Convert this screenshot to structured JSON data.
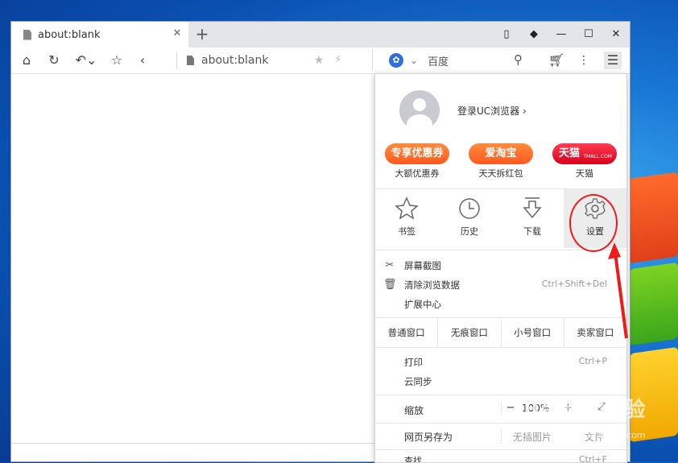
{
  "tab": {
    "title": "about:blank"
  },
  "address": {
    "url": "about:blank"
  },
  "search": {
    "engine_label": "百度"
  },
  "menu": {
    "login_text": "登录UC浏览器",
    "promos": [
      {
        "badge": "专享优惠券",
        "caption": "大额优惠券"
      },
      {
        "badge": "爱淘宝",
        "caption": "天天拆红包"
      },
      {
        "badge": "天猫",
        "sub": "TMALL.COM",
        "caption": "天猫"
      }
    ],
    "icons": [
      {
        "label": "书签"
      },
      {
        "label": "历史"
      },
      {
        "label": "下载"
      },
      {
        "label": "设置"
      }
    ],
    "rows": [
      {
        "label": "屏幕截图",
        "shortcut": ""
      },
      {
        "label": "清除浏览数据",
        "shortcut": "Ctrl+Shift+Del"
      },
      {
        "label": "扩展中心",
        "shortcut": ""
      }
    ],
    "windows": [
      "普通窗口",
      "无痕窗口",
      "小号窗口",
      "卖家窗口"
    ],
    "print": {
      "label": "打印",
      "shortcut": "Ctrl+P"
    },
    "sync": {
      "label": "云同步"
    },
    "zoom": {
      "label": "缩放",
      "value": "100%",
      "minus": "−",
      "plus": "+"
    },
    "save": {
      "label": "网页另存为",
      "opt1": "无插图片",
      "opt2": "文件"
    },
    "last": {
      "label": "查找",
      "shortcut": "Ctrl+F"
    }
  },
  "watermark": {
    "main": "Baidu 经验",
    "sub": "jingyan.baidu.com"
  },
  "colors": {
    "highlight": "#f01a1a",
    "accent_orange": "#ff5a1f",
    "tmall_red": "#d8001c"
  }
}
